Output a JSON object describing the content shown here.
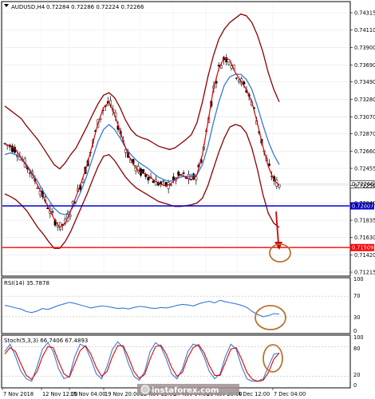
{
  "header": {
    "symbol_label": "AUDUSD,H4",
    "ohlc": "0.72284 0.72286 0.72224 0.72266"
  },
  "rsi": {
    "label": "RSI(14) 35.7878",
    "levels": [
      "100",
      "70",
      "30",
      "0"
    ]
  },
  "stoch": {
    "label": "Stoch(5,3,3) 66.7406 67.4893",
    "levels": [
      "100",
      "80",
      "20",
      "0"
    ]
  },
  "watermark": "instaforex.com",
  "chart_data": {
    "type": "candlestick",
    "price_ticks": [
      "0.74315",
      "0.74110",
      "0.73900",
      "0.73690",
      "0.73490",
      "0.73280",
      "0.73070",
      "0.72870",
      "0.72660",
      "0.72455",
      "0.72250",
      "0.72040",
      "0.71835",
      "0.71630",
      "0.71420",
      "0.71215"
    ],
    "time_ticks": [
      "7 Nov 2018",
      "12 Nov 12:00",
      "15 Nov 04:00",
      "19 Nov 20:00",
      "22 Nov 12:00",
      "27 Nov 04:00",
      "29 Nov 20:00",
      "4 Dec 12:00",
      "7 Dec 04:00"
    ],
    "current_price": "0.72266",
    "hlines": [
      {
        "value": "0.72007",
        "color": "#0000cc"
      },
      {
        "value": "0.71509",
        "color": "#ff0000"
      }
    ],
    "series": [
      {
        "values": [
          0.7275,
          0.7272,
          0.7268,
          0.7258,
          0.7248,
          0.7238,
          0.7225,
          0.7212,
          0.7198,
          0.7185,
          0.7175,
          0.718,
          0.7195,
          0.7212,
          0.723,
          0.725,
          0.7275,
          0.73,
          0.7318,
          0.7325,
          0.731,
          0.729,
          0.727,
          0.7255,
          0.7245,
          0.724,
          0.7238,
          0.7232,
          0.7228,
          0.7225,
          0.7226,
          0.7232,
          0.7238,
          0.7235,
          0.7232,
          0.7238,
          0.7262,
          0.73,
          0.734,
          0.7365,
          0.7378,
          0.7375,
          0.736,
          0.735,
          0.734,
          0.7325,
          0.73,
          0.7272,
          0.7248,
          0.7232,
          0.7225
        ]
      },
      {
        "values": [
          0.7262,
          0.7264,
          0.7262,
          0.7258,
          0.725,
          0.724,
          0.723,
          0.7218,
          0.7208,
          0.7198,
          0.7192,
          0.719,
          0.7195,
          0.7205,
          0.722,
          0.7238,
          0.7258,
          0.7278,
          0.7292,
          0.7298,
          0.7292,
          0.7282,
          0.727,
          0.7262,
          0.7255,
          0.725,
          0.7246,
          0.724,
          0.7235,
          0.7232,
          0.723,
          0.7232,
          0.7235,
          0.7236,
          0.7236,
          0.7238,
          0.725,
          0.7272,
          0.73,
          0.7325,
          0.7345,
          0.7355,
          0.7358,
          0.7358,
          0.7352,
          0.734,
          0.732,
          0.7298,
          0.7278,
          0.7262,
          0.725
        ]
      },
      {
        "values": [
          0.732,
          0.7315,
          0.731,
          0.7305,
          0.7296,
          0.7288,
          0.728,
          0.727,
          0.726,
          0.725,
          0.7245,
          0.7252,
          0.7262,
          0.727,
          0.7283,
          0.7296,
          0.731,
          0.7323,
          0.7333,
          0.7336,
          0.733,
          0.7318,
          0.7303,
          0.7292,
          0.7285,
          0.7282,
          0.728,
          0.7276,
          0.7272,
          0.727,
          0.7268,
          0.727,
          0.7275,
          0.728,
          0.7286,
          0.73,
          0.7325,
          0.7355,
          0.738,
          0.74,
          0.7412,
          0.742,
          0.7425,
          0.743,
          0.7428,
          0.742,
          0.7405,
          0.7385,
          0.736,
          0.734,
          0.7325
        ]
      },
      {
        "values": [
          0.7215,
          0.7212,
          0.7208,
          0.7202,
          0.7195,
          0.7185,
          0.7175,
          0.7167,
          0.7158,
          0.715,
          0.715,
          0.7158,
          0.717,
          0.7185,
          0.72,
          0.7215,
          0.7232,
          0.7248,
          0.726,
          0.7262,
          0.7255,
          0.7245,
          0.7235,
          0.7228,
          0.7222,
          0.7218,
          0.7214,
          0.721,
          0.7206,
          0.7204,
          0.7202,
          0.72,
          0.72,
          0.7201,
          0.7202,
          0.7204,
          0.721,
          0.7225,
          0.7245,
          0.7265,
          0.7282,
          0.7295,
          0.7298,
          0.7296,
          0.7288,
          0.727,
          0.7245,
          0.7215,
          0.7192,
          0.718,
          0.7175
        ]
      }
    ],
    "rsi_values": [
      52,
      50,
      47,
      45,
      40,
      38,
      41,
      46,
      44,
      48,
      52,
      55,
      58,
      56,
      53,
      50,
      47,
      49,
      51,
      50,
      48,
      46,
      47,
      45,
      48,
      50,
      49,
      47,
      46,
      48,
      47,
      49,
      52,
      54,
      53,
      51,
      55,
      58,
      60,
      57,
      62,
      59,
      57,
      55,
      52,
      48,
      40,
      34,
      30,
      32,
      36,
      35
    ],
    "stoch_series": [
      {
        "values": [
          70,
          85,
          60,
          30,
          15,
          10,
          40,
          75,
          88,
          70,
          35,
          15,
          20,
          60,
          85,
          80,
          55,
          25,
          15,
          40,
          75,
          90,
          78,
          45,
          20,
          12,
          30,
          70,
          88,
          80,
          55,
          25,
          15,
          35,
          70,
          85,
          82,
          60,
          30,
          15,
          25,
          60,
          85,
          75,
          40,
          15,
          10,
          10,
          15,
          40,
          65,
          67
        ]
      },
      {
        "values": [
          65,
          78,
          70,
          45,
          22,
          14,
          30,
          60,
          80,
          78,
          50,
          25,
          18,
          45,
          72,
          82,
          65,
          38,
          20,
          30,
          60,
          82,
          82,
          58,
          30,
          16,
          24,
          55,
          80,
          83,
          65,
          38,
          20,
          28,
          58,
          78,
          84,
          68,
          42,
          22,
          22,
          48,
          75,
          78,
          55,
          28,
          14,
          10,
          12,
          28,
          55,
          67
        ]
      }
    ]
  }
}
